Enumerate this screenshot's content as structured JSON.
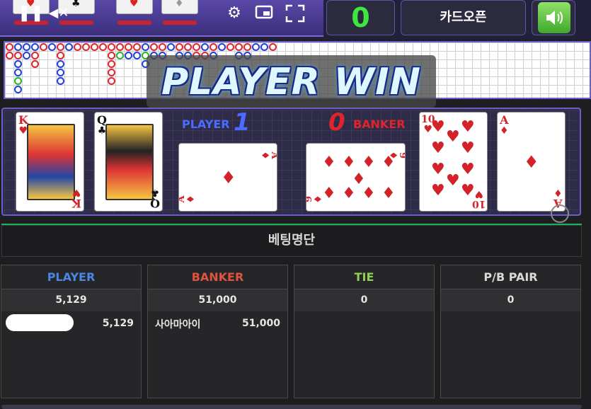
{
  "controls": {
    "pause_icon": "pause-icon",
    "mute_icon": "mute-icon",
    "settings_icon": "gear-icon",
    "pip_icon": "picture-in-picture-icon",
    "fullscreen_icon": "fullscreen-icon",
    "sound_icon": "speaker-icon"
  },
  "header": {
    "countdown": "0",
    "card_open_label": "카드오픈"
  },
  "result_banner": "PLAYER WIN",
  "player": {
    "label": "PLAYER",
    "score": "1",
    "cards": [
      {
        "rank": "K",
        "suit": "♥",
        "color": "red"
      },
      {
        "rank": "Q",
        "suit": "♣",
        "color": "black"
      },
      {
        "rank": "A",
        "suit": "♦",
        "color": "red"
      }
    ]
  },
  "banker": {
    "label": "BANKER",
    "score": "0",
    "cards": [
      {
        "rank": "9",
        "suit": "♦",
        "color": "red"
      },
      {
        "rank": "10",
        "suit": "♥",
        "color": "red"
      },
      {
        "rank": "A",
        "suit": "♦",
        "color": "red"
      }
    ]
  },
  "bet_list": {
    "title": "베팅명단",
    "columns": [
      {
        "header": "PLAYER",
        "color": "#4a86e8",
        "total": "5,129",
        "rows": [
          {
            "name": "",
            "amount": "5,129"
          }
        ]
      },
      {
        "header": "BANKER",
        "color": "#e0533f",
        "total": "51,000",
        "rows": [
          {
            "name": "사아마아이",
            "amount": "51,000"
          }
        ]
      },
      {
        "header": "TIE",
        "color": "#8fd14f",
        "total": "0",
        "rows": []
      },
      {
        "header": "P/B PAIR",
        "color": "#d9d9d9",
        "total": "0",
        "rows": []
      }
    ]
  },
  "colors": {
    "player_blue": "#1f3fdc",
    "banker_red": "#e0242e",
    "tie_green": "#27b427",
    "score_green": "#3fe63f"
  }
}
